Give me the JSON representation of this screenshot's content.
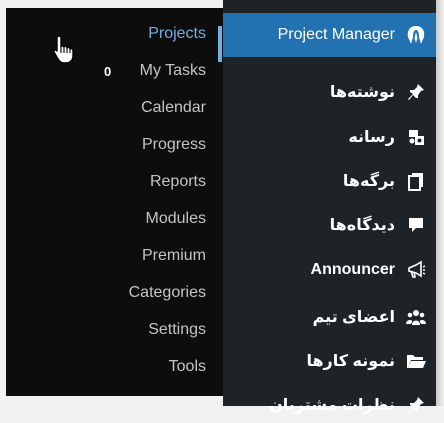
{
  "menu": {
    "current": {
      "label": "Project Manager",
      "icon": "project-manager-logo-icon"
    },
    "items": [
      {
        "label": "نوشته‌ها",
        "icon": "pushpin-icon"
      },
      {
        "label": "رسانه",
        "icon": "media-icon"
      },
      {
        "label": "برگه‌ها",
        "icon": "pages-icon"
      },
      {
        "label": "دیدگاه‌ها",
        "icon": "comment-icon"
      },
      {
        "label": "Announcer",
        "icon": "megaphone-icon"
      },
      {
        "label": "اعضای تیم",
        "icon": "team-icon"
      },
      {
        "label": "نمونه کارها",
        "icon": "folder-icon"
      },
      {
        "label": "نظرات مشتریان",
        "icon": "pushpin-icon"
      }
    ]
  },
  "submenu": {
    "items": [
      {
        "label": "Projects",
        "active": true
      },
      {
        "label": "My Tasks",
        "badge": "0"
      },
      {
        "label": "Calendar"
      },
      {
        "label": "Progress"
      },
      {
        "label": "Reports"
      },
      {
        "label": "Modules"
      },
      {
        "label": "Premium"
      },
      {
        "label": "Categories"
      },
      {
        "label": "Settings"
      },
      {
        "label": "Tools"
      }
    ]
  },
  "colors": {
    "menu_bg": "#1d2327",
    "submenu_bg": "#0d0d0d",
    "current_bg": "#2271b1",
    "active_link": "#72aee6",
    "link": "#c3c4c7"
  }
}
